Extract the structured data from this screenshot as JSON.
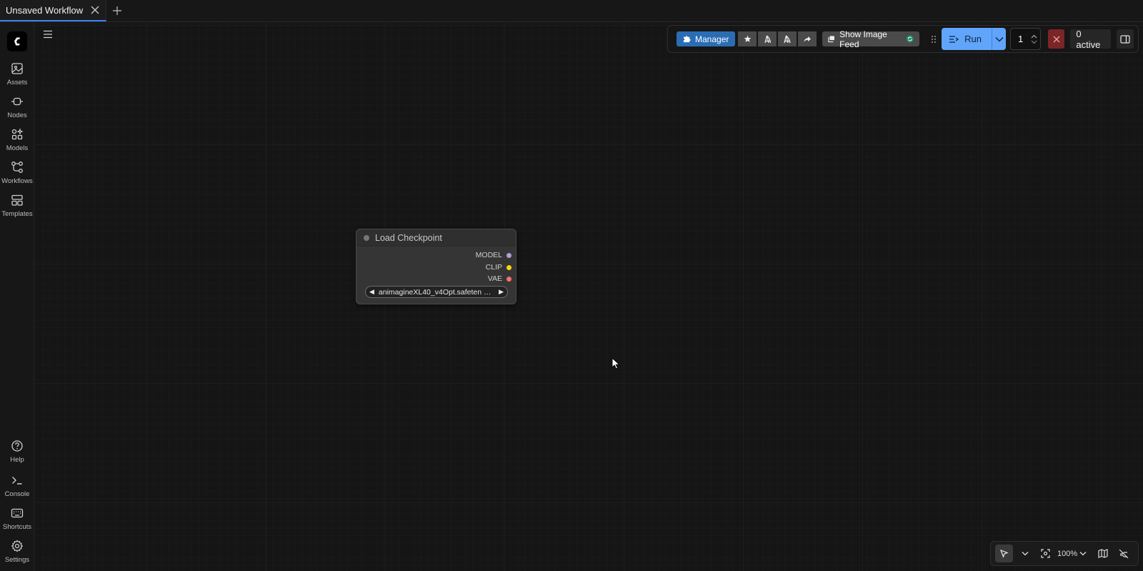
{
  "tabs": [
    {
      "label": "Unsaved Workflow"
    }
  ],
  "sidebar": {
    "top": [
      {
        "label": "Assets",
        "icon": "image-icon"
      },
      {
        "label": "Nodes",
        "icon": "node-icon"
      },
      {
        "label": "Models",
        "icon": "model-icon"
      },
      {
        "label": "Workflows",
        "icon": "workflow-icon"
      },
      {
        "label": "Templates",
        "icon": "template-icon"
      }
    ],
    "bottom": [
      {
        "label": "Help",
        "icon": "help-icon"
      },
      {
        "label": "Console",
        "icon": "console-icon"
      },
      {
        "label": "Shortcuts",
        "icon": "keyboard-icon"
      },
      {
        "label": "Settings",
        "icon": "gear-icon"
      }
    ]
  },
  "toolbar": {
    "manager_label": "Manager",
    "image_feed_label": "Show Image Feed",
    "run_label": "Run",
    "batch_count": "1",
    "queue_status": "0 active",
    "colors": {
      "manager": "#2a6db5",
      "run": "#60a5fa",
      "cancel": "#7a2626"
    }
  },
  "node": {
    "title": "Load Checkpoint",
    "outputs": [
      {
        "name": "MODEL",
        "color": "#b39ddb"
      },
      {
        "name": "CLIP",
        "color": "#f5d90a"
      },
      {
        "name": "VAE",
        "color": "#ff6e6e"
      }
    ],
    "widget_value": "animagineXL40_v4Opt.safeten …"
  },
  "bottom_controls": {
    "zoom": "100%"
  }
}
